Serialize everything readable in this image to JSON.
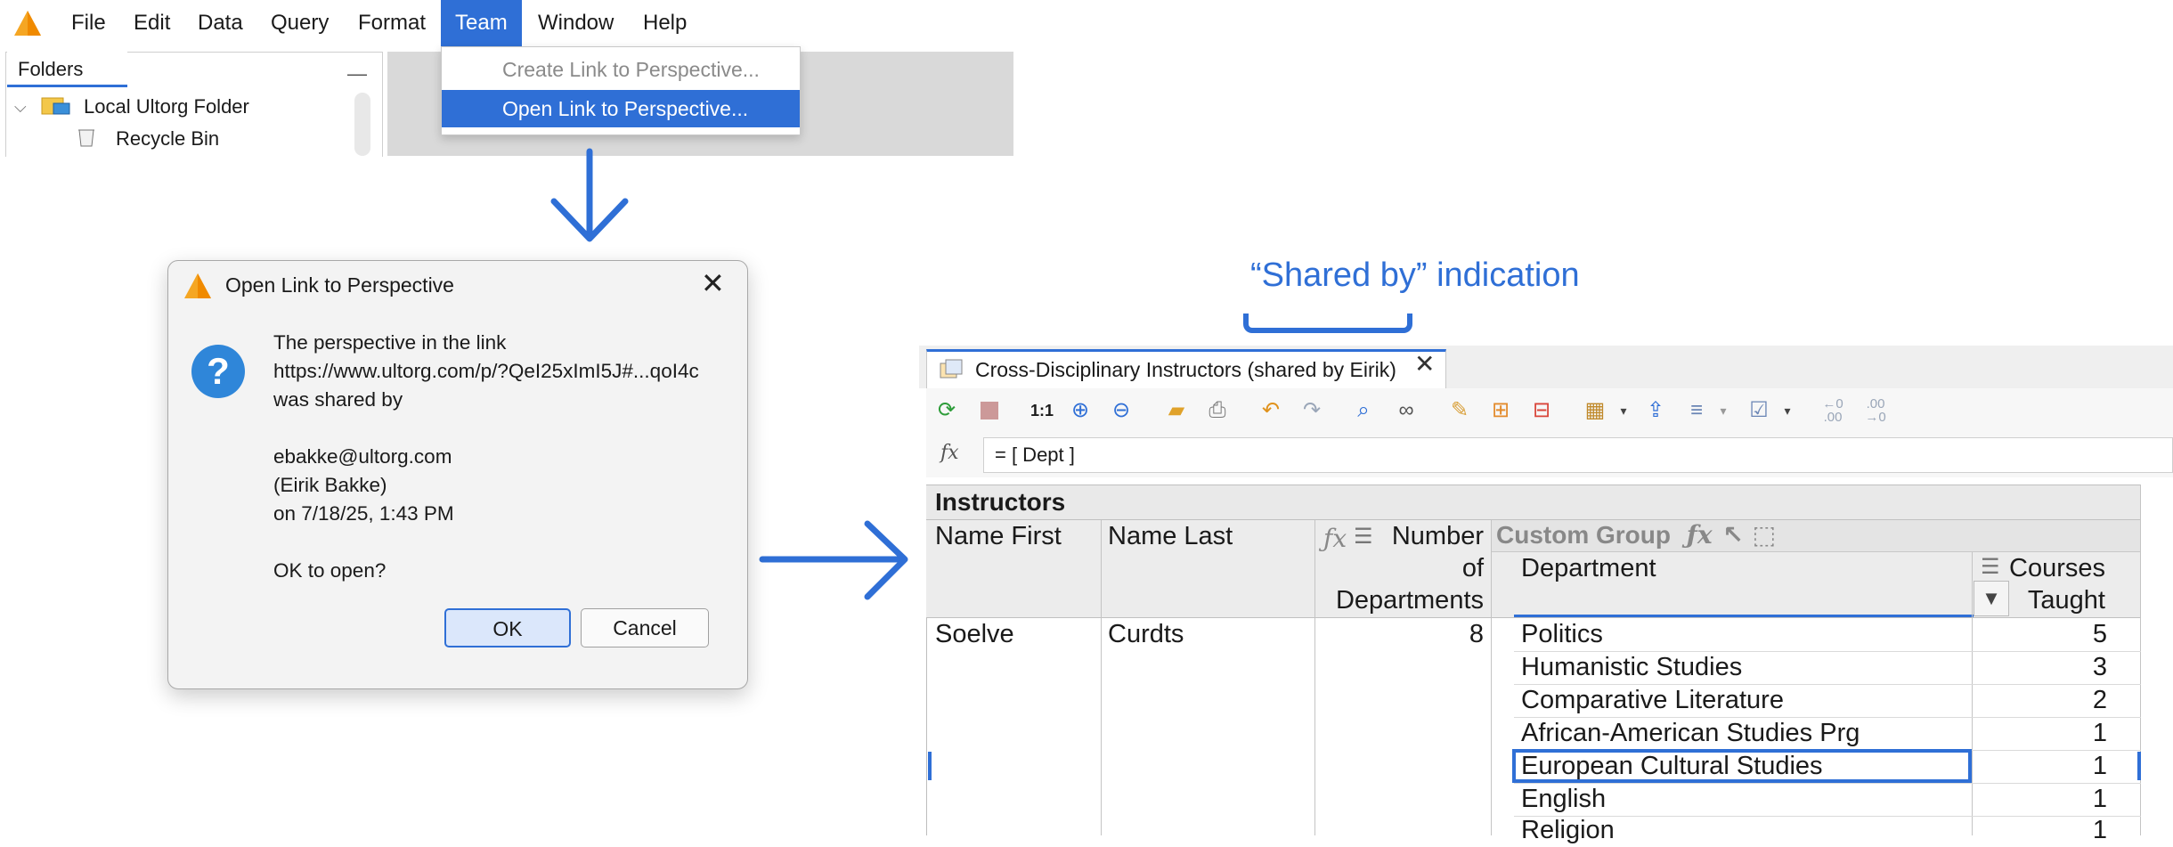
{
  "menubar": {
    "items": [
      "File",
      "Edit",
      "Data",
      "Query",
      "Format",
      "Team",
      "Window",
      "Help"
    ],
    "active_index": 5
  },
  "folders": {
    "tab_label": "Folders",
    "minimize": "—",
    "items": [
      "Local Ultorg Folder",
      "Recycle Bin"
    ]
  },
  "team_menu": {
    "items": [
      "Create Link to Perspective...",
      "Open Link to Perspective..."
    ]
  },
  "dialog": {
    "title": "Open Link to Perspective",
    "icon": "?",
    "lines": [
      "The perspective in the link",
      "https://www.ultorg.com/p/?QeI25xImI5J#...qoI4c",
      "was shared by",
      "",
      "ebakke@ultorg.com",
      "(Eirik Bakke)",
      "on 7/18/25, 1:43 PM",
      "",
      "OK to open?"
    ],
    "ok_label": "OK",
    "cancel_label": "Cancel"
  },
  "annotation": {
    "label": "“Shared by” indication"
  },
  "perspective": {
    "tab_title": "Cross-Disciplinary Instructors (shared by Eirik)",
    "tab_close": "✕",
    "formula_icon": "fx",
    "formula": "= [ Dept ]",
    "toolbar_icons": [
      "refresh-icon",
      "stop-icon",
      "zoom-reset-icon",
      "zoom-in-icon",
      "zoom-out-icon",
      "open-folder-icon",
      "print-icon",
      "undo-icon",
      "redo-icon",
      "find-icon",
      "binoculars-icon",
      "edit-formula-icon",
      "add-column-icon",
      "remove-column-icon",
      "table-layout-icon",
      "export-icon",
      "align-icon",
      "checkbox-icon",
      "decrease-decimals-icon",
      "increase-decimals-icon"
    ],
    "zoom_label": "1:1",
    "decimals_left": "←0 .00",
    "decimals_right": ".00 →0",
    "table": {
      "title": "Instructors",
      "headers": {
        "name_first": "Name First",
        "name_last": "Name Last",
        "num_depts_line1": "Number",
        "num_depts_line2": "of",
        "num_depts_line3": "Departments",
        "custom_group": "Custom Group",
        "department": "Department",
        "courses_line1": "Courses",
        "courses_line2": "Taught"
      },
      "row": {
        "name_first": "Soelve",
        "name_last": "Curdts",
        "num_depts": "8"
      },
      "departments": [
        {
          "name": "Politics",
          "courses": "5"
        },
        {
          "name": "Humanistic Studies",
          "courses": "3"
        },
        {
          "name": "Comparative Literature",
          "courses": "2"
        },
        {
          "name": "African-American Studies Prg",
          "courses": "1"
        },
        {
          "name": "European Cultural Studies",
          "courses": "1"
        },
        {
          "name": "English",
          "courses": "1"
        },
        {
          "name": "Religion",
          "courses": "1"
        }
      ]
    }
  },
  "colors": {
    "accent": "#2f6fd6",
    "annotation": "#2f6fd6",
    "question_icon": "#2f86d9"
  }
}
